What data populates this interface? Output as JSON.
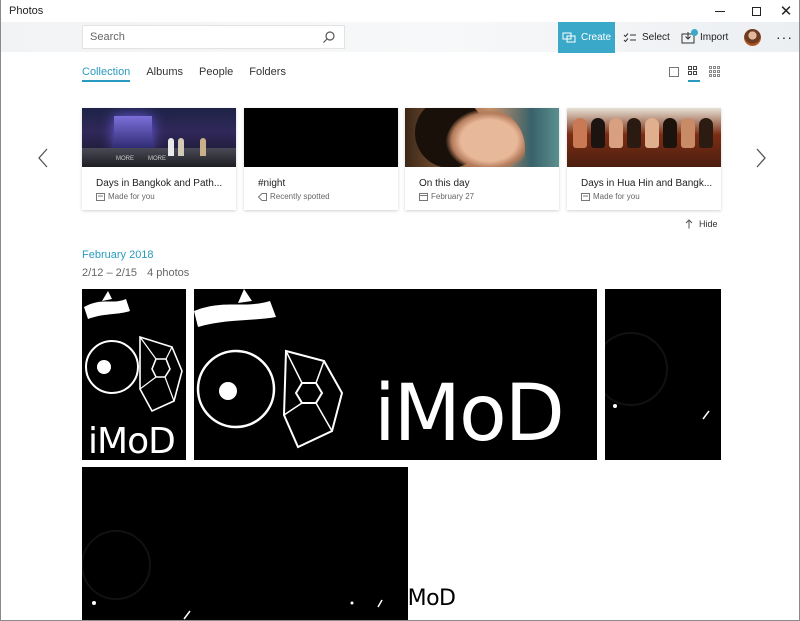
{
  "window": {
    "title": "Photos",
    "minimize_glyph": "—",
    "maximize_glyph": "□",
    "close_glyph": "✕"
  },
  "toolbar": {
    "search_placeholder": "Search",
    "create_label": "Create",
    "select_label": "Select",
    "import_label": "Import",
    "more_label": "···",
    "accent": "#3aa9c9"
  },
  "tabs": [
    {
      "label": "Collection",
      "active": true
    },
    {
      "label": "Albums",
      "active": false
    },
    {
      "label": "People",
      "active": false
    },
    {
      "label": "Folders",
      "active": false
    }
  ],
  "view_modes": [
    "single-view-icon",
    "medium-grid-icon",
    "small-grid-icon"
  ],
  "cards": [
    {
      "title": "Days in Bangkok and Path...",
      "subtitle": "Made for you",
      "icon": "album-icon"
    },
    {
      "title": "#night",
      "subtitle": "Recently spotted",
      "icon": "tag-icon"
    },
    {
      "title": "On this day",
      "subtitle": "February 27",
      "icon": "calendar-icon"
    },
    {
      "title": "Days in Hua Hin and Bangk...",
      "subtitle": "Made for you",
      "icon": "album-icon"
    }
  ],
  "thumb1_signs": [
    "MORE",
    "MORE"
  ],
  "hide_label": "Hide",
  "section": {
    "month": "February 2018",
    "date_range": "2/12 – 2/15",
    "count": "4 photos"
  },
  "photos": {
    "logo_text": "iMoD",
    "overlay_text": "iMoD"
  }
}
